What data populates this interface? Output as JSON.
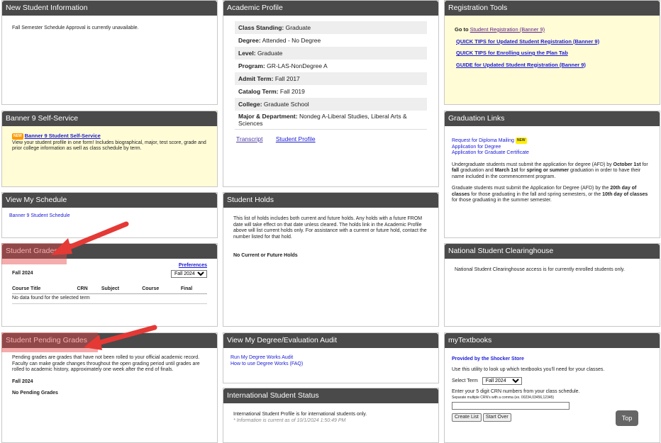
{
  "panels": {
    "new_student": {
      "title": "New Student Information",
      "text": "Fall Semester Schedule Approval is currently unavailable."
    },
    "academic_profile": {
      "title": "Academic Profile",
      "rows": [
        {
          "label": "Class Standing:",
          "value": "Graduate"
        },
        {
          "label": "Degree:",
          "value": "Attended - No Degree"
        },
        {
          "label": "Level:",
          "value": "Graduate"
        },
        {
          "label": "Program:",
          "value": "GR-LAS-NonDegree A"
        },
        {
          "label": "Admit Term:",
          "value": "Fall 2017"
        },
        {
          "label": "Catalog Term:",
          "value": "Fall 2019"
        },
        {
          "label": "College:",
          "value": "Graduate School"
        },
        {
          "label": "Major & Department:",
          "value": "Nondeg A-Liberal Studies, Liberal Arts & Sciences"
        }
      ],
      "link_transcript": "Transcript",
      "link_profile": "Student Profile"
    },
    "registration_tools": {
      "title": "Registration Tools",
      "goto_prefix": "Go to",
      "goto_link": "Student Registration (Banner 9)",
      "links": [
        "QUICK TIPS for Updated Student Registration (Banner 9)",
        "QUICK TIPS for Enrolling using the Plan Tab",
        "GUIDE for Updated Student Registration (Banner 9)"
      ]
    },
    "banner9": {
      "title": "Banner 9 Self-Service",
      "badge": "NEW",
      "link": "Banner 9 Student Self-Service",
      "text": "View your student profile in one form!  Includes biographical, major, test score, grade and prior college information as well as class schedule by term."
    },
    "graduation_links": {
      "title": "Graduation Links",
      "link1": "Request for Diploma Mailing",
      "badge": "NEW",
      "link2": "Application for Degree",
      "link3": "Application for Graduate Certificate",
      "p1_a": "Undergraduate students must submit the application for degree (AFD) by ",
      "p1_b": "October 1st",
      "p1_c": " for ",
      "p1_d": "fall",
      "p1_e": " graduation and ",
      "p1_f": "March 1st",
      "p1_g": " for ",
      "p1_h": "spring or summer",
      "p1_i": " graduation in order to have their name included in the commencement program.",
      "p2_a": "Graduate students must submit the Application for Degree (AFD) by the ",
      "p2_b": "20th day of classes",
      "p2_c": " for those graduating in the fall and spring semesters, or the ",
      "p2_d": "10th day of classes",
      "p2_e": " for those graduating in the summer semester."
    },
    "view_schedule": {
      "title": "View My Schedule",
      "link": "Banner 9 Student Schedule"
    },
    "student_holds": {
      "title": "Student Holds",
      "text": "This list of holds includes both current and future holds. Any holds with a future FROM date will take effect on that date unless cleared. The holds link in the Academic Profile above will list current holds only. For assistance with a current or future hold, contact the number listed for that hold.",
      "status": "No Current or Future Holds"
    },
    "student_grades": {
      "title": "Student Grades",
      "preferences": "Preferences",
      "term": "Fall 2024",
      "select_value": "Fall 2024",
      "columns": [
        "Course Title",
        "CRN",
        "Subject",
        "Course",
        "Final"
      ],
      "empty": "No data found for the selected term"
    },
    "clearinghouse": {
      "title": "National Student Clearinghouse",
      "text": "National Student Clearinghouse access is for currently enrolled students only."
    },
    "pending_grades": {
      "title": "Student Pending Grades",
      "text": "Pending grades are grades that have not been rolled to your official academic record. Faculty can make grade changes throughout the open grading period until grades are rolled to academic history, approximately one week after the end of finals.",
      "term": "Fall 2024",
      "status": "No Pending Grades"
    },
    "degree_audit": {
      "title": "View My Degree/Evaluation Audit",
      "link1": "Run My Degree Works Audit",
      "link2": "How to use Degree Works (FAQ)"
    },
    "international": {
      "title": "International Student Status",
      "text": "International Student Profile is for international students only.",
      "note": "* Information is current as of 10/1/2024 1:50:49 PM"
    },
    "textbooks": {
      "title": "myTextbooks",
      "provided": "Provided by the Shocker Store",
      "intro": "Use this utility to look up which textbooks you'll need for your classes.",
      "select_label": "Select Term",
      "select_value": "Fall 2024",
      "crn_label": "Enter your 5 digit CRN numbers from your class schedule.",
      "crn_hint": "Separate multiple CRN's with a comma (ex. 00234,03456,12345)",
      "btn_create": "Create List",
      "btn_start": "Start Over"
    }
  },
  "top_button": "Top",
  "colors": {
    "header": "#4a4a4a",
    "header_highlight": "#8b1a1a",
    "yellow_panel": "#fffcd6",
    "link": "#1a1ad6",
    "annotation_arrow": "#e53935"
  }
}
